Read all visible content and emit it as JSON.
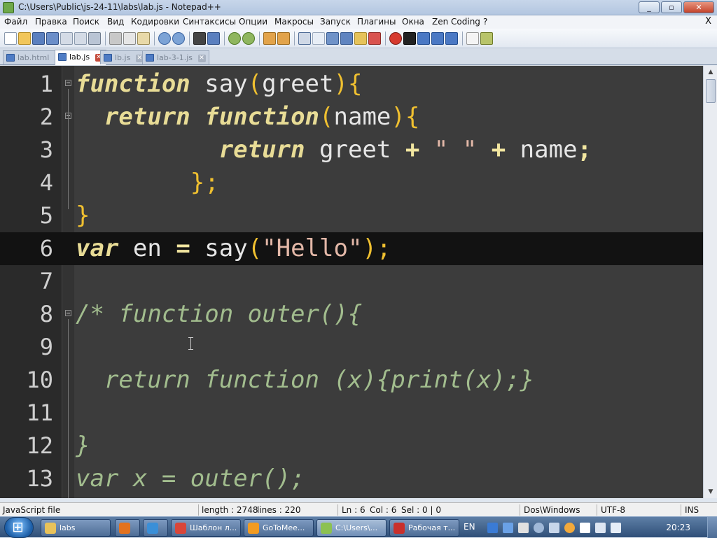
{
  "window": {
    "title": "C:\\Users\\Public\\js-24-11\\labs\\lab.js - Notepad++",
    "minimize_label": "_",
    "maximize_label": "▫",
    "close_label": "✕"
  },
  "menu": {
    "items": [
      "Файл",
      "Правка",
      "Поиск",
      "Вид",
      "Кодировки",
      "Синтаксисы",
      "Опции",
      "Макросы",
      "Запуск",
      "Плагины",
      "Окна",
      "Zen Coding",
      "?"
    ],
    "close_doc_label": "X"
  },
  "toolbar": {
    "icons": [
      "new-icon",
      "open-icon",
      "save-icon",
      "save-all-icon",
      "close-icon",
      "close-all-icon",
      "print-icon",
      "cut-icon",
      "copy-icon",
      "paste-icon",
      "undo-icon",
      "redo-icon",
      "find-icon",
      "replace-icon",
      "zoom-in-icon",
      "zoom-out-icon",
      "sync-v-icon",
      "sync-h-icon",
      "wrap-icon",
      "all-chars-icon",
      "indent-guide-icon",
      "udl-icon",
      "doc-map-icon",
      "function-list-icon",
      "record-macro-icon",
      "stop-macro-icon",
      "play-macro-icon",
      "run-macro-icon",
      "save-macro-icon",
      "spellcheck-icon",
      "plugin-icon"
    ]
  },
  "tabs": [
    {
      "label": "lab.html",
      "active": false
    },
    {
      "label": "lab.js",
      "active": true
    },
    {
      "label": "lb.js",
      "active": false
    },
    {
      "label": "lab-3-1.js",
      "active": false
    }
  ],
  "editor": {
    "current_line": 6,
    "lines": [
      {
        "n": "1",
        "tokens": [
          {
            "t": "function",
            "c": "kw"
          },
          {
            "t": " say",
            "c": "plain"
          },
          {
            "t": "(",
            "c": "br"
          },
          {
            "t": "greet",
            "c": "plain"
          },
          {
            "t": "){",
            "c": "br"
          }
        ]
      },
      {
        "n": "2",
        "tokens": [
          {
            "t": "  ",
            "c": "plain"
          },
          {
            "t": "return",
            "c": "kw"
          },
          {
            "t": " ",
            "c": "plain"
          },
          {
            "t": "function",
            "c": "kw"
          },
          {
            "t": "(",
            "c": "br"
          },
          {
            "t": "name",
            "c": "plain"
          },
          {
            "t": "){",
            "c": "br"
          }
        ]
      },
      {
        "n": "3",
        "tokens": [
          {
            "t": "          ",
            "c": "plain"
          },
          {
            "t": "return",
            "c": "kw"
          },
          {
            "t": " greet ",
            "c": "plain"
          },
          {
            "t": "+",
            "c": "op"
          },
          {
            "t": " ",
            "c": "plain"
          },
          {
            "t": "\" \"",
            "c": "str"
          },
          {
            "t": " ",
            "c": "plain"
          },
          {
            "t": "+",
            "c": "op"
          },
          {
            "t": " name",
            "c": "plain"
          },
          {
            "t": ";",
            "c": "op"
          }
        ]
      },
      {
        "n": "4",
        "tokens": [
          {
            "t": "        ",
            "c": "plain"
          },
          {
            "t": "};",
            "c": "br"
          }
        ]
      },
      {
        "n": "5",
        "tokens": [
          {
            "t": "}",
            "c": "br"
          }
        ]
      },
      {
        "n": "6",
        "tokens": [
          {
            "t": "var",
            "c": "kw"
          },
          {
            "t": " en ",
            "c": "plain"
          },
          {
            "t": "=",
            "c": "op"
          },
          {
            "t": " say",
            "c": "plain"
          },
          {
            "t": "(",
            "c": "br"
          },
          {
            "t": "\"Hello\"",
            "c": "str"
          },
          {
            "t": ");",
            "c": "br"
          }
        ]
      },
      {
        "n": "7",
        "tokens": []
      },
      {
        "n": "8",
        "tokens": [
          {
            "t": "/* function outer(){",
            "c": "cmt"
          }
        ]
      },
      {
        "n": "9",
        "tokens": []
      },
      {
        "n": "10",
        "tokens": [
          {
            "t": "  return function (x){print(x);}",
            "c": "cmt"
          }
        ]
      },
      {
        "n": "11",
        "tokens": []
      },
      {
        "n": "12",
        "tokens": [
          {
            "t": "}",
            "c": "cmt"
          }
        ]
      },
      {
        "n": "13",
        "tokens": [
          {
            "t": "var x = outer();",
            "c": "cmt"
          }
        ]
      }
    ]
  },
  "status": {
    "file_type": "JavaScript file",
    "length": "length : 2748",
    "lines": "lines : 220",
    "ln": "Ln : 6",
    "col": "Col : 6",
    "sel": "Sel : 0 | 0",
    "eol": "Dos\\Windows",
    "encoding": "UTF-8",
    "mode": "INS"
  },
  "taskbar": {
    "tasks": [
      {
        "label": "labs",
        "icon": "folder-icon",
        "color": "#e8c25a"
      },
      {
        "label": "",
        "icon": "firefox-icon",
        "color": "#e2721f"
      },
      {
        "label": "",
        "icon": "ie-icon",
        "color": "#3a8fd8"
      },
      {
        "label": "Шаблон л...",
        "icon": "chrome-icon",
        "color": "#d9463a"
      },
      {
        "label": "GoToMee...",
        "icon": "gotomeeting-icon",
        "color": "#f29b21"
      },
      {
        "label": "C:\\Users\\...",
        "icon": "notepadpp-icon",
        "color": "#8cc152"
      },
      {
        "label": "Рабочая т...",
        "icon": "pdf-icon",
        "color": "#c9302c"
      }
    ],
    "language": "EN",
    "clock": "20:23"
  },
  "colors": {
    "editor_bg": "#3c3c3c",
    "current_line_bg": "#121212",
    "keyword": "#e8dc96",
    "comment": "#a2bd8e",
    "string": "#e3b8a8"
  }
}
